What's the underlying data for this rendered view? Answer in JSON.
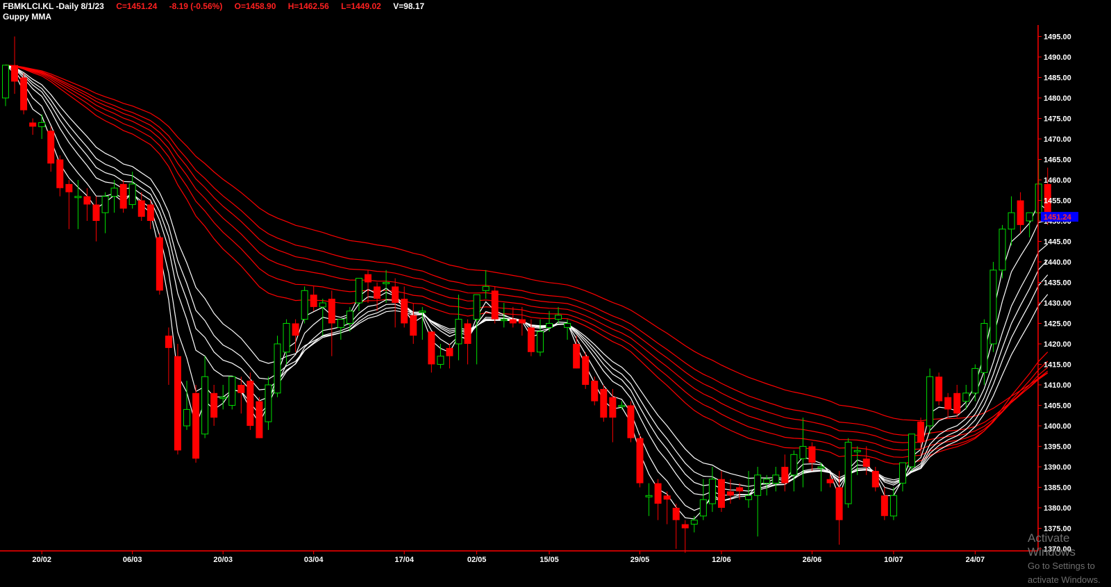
{
  "header": {
    "symbol": "FBMKLCI.KL",
    "period": "-Daily",
    "date": "8/1/23",
    "close": "C=1451.24",
    "change": "-8.19 (-0.56%)",
    "open": "O=1458.90",
    "high": "H=1462.56",
    "low": "L=1449.02",
    "volume": "V=98.17",
    "indicator": "Guppy MMA"
  },
  "price_tag": "1451.24",
  "watermark": {
    "line1": "Activate Windows",
    "line2": "Go to Settings to activate Windows."
  },
  "colors": {
    "background": "#000000",
    "up": "#00e000",
    "down": "#ff0000",
    "short_mma": "#ffffff",
    "long_mma": "#ff0000",
    "axis": "#ff0000",
    "axis_text": "#ffffff",
    "price_tag_bg": "#0000ff",
    "price_tag_text": "#ff3030"
  },
  "chart_data": {
    "type": "candlestick",
    "title": "FBMKLCI.KL -Daily 8/1/23",
    "ylim": [
      1368,
      1497
    ],
    "y_ticks": [
      1370,
      1375,
      1380,
      1385,
      1390,
      1395,
      1400,
      1405,
      1410,
      1415,
      1420,
      1425,
      1430,
      1435,
      1440,
      1445,
      1450,
      1455,
      1460,
      1465,
      1470,
      1475,
      1480,
      1485,
      1490,
      1495
    ],
    "x_ticks": [
      {
        "label": "20/02",
        "index": 4
      },
      {
        "label": "06/03",
        "index": 14
      },
      {
        "label": "20/03",
        "index": 24
      },
      {
        "label": "03/04",
        "index": 34
      },
      {
        "label": "17/04",
        "index": 44
      },
      {
        "label": "02/05",
        "index": 52
      },
      {
        "label": "15/05",
        "index": 60
      },
      {
        "label": "29/05",
        "index": 70
      },
      {
        "label": "12/06",
        "index": 79
      },
      {
        "label": "26/06",
        "index": 89
      },
      {
        "label": "10/07",
        "index": 98
      },
      {
        "label": "24/07",
        "index": 107
      }
    ],
    "candles": [
      {
        "o": 1480,
        "h": 1488,
        "l": 1478,
        "c": 1488
      },
      {
        "o": 1488,
        "h": 1495,
        "l": 1481,
        "c": 1484
      },
      {
        "o": 1485,
        "h": 1486,
        "l": 1476,
        "c": 1477
      },
      {
        "o": 1474,
        "h": 1475,
        "l": 1471,
        "c": 1473
      },
      {
        "o": 1473,
        "h": 1476,
        "l": 1470,
        "c": 1474
      },
      {
        "o": 1472,
        "h": 1473,
        "l": 1462,
        "c": 1464
      },
      {
        "o": 1465,
        "h": 1466,
        "l": 1456,
        "c": 1458
      },
      {
        "o": 1459,
        "h": 1460,
        "l": 1448,
        "c": 1457
      },
      {
        "o": 1456,
        "h": 1460,
        "l": 1448,
        "c": 1456
      },
      {
        "o": 1456,
        "h": 1458,
        "l": 1450,
        "c": 1454
      },
      {
        "o": 1454,
        "h": 1456,
        "l": 1445,
        "c": 1450
      },
      {
        "o": 1452,
        "h": 1457,
        "l": 1447,
        "c": 1456
      },
      {
        "o": 1456,
        "h": 1460,
        "l": 1452,
        "c": 1458
      },
      {
        "o": 1459,
        "h": 1460,
        "l": 1452,
        "c": 1453
      },
      {
        "o": 1454,
        "h": 1462,
        "l": 1453,
        "c": 1459
      },
      {
        "o": 1455,
        "h": 1457,
        "l": 1450,
        "c": 1451
      },
      {
        "o": 1454,
        "h": 1455,
        "l": 1448,
        "c": 1450
      },
      {
        "o": 1446,
        "h": 1447,
        "l": 1432,
        "c": 1433
      },
      {
        "o": 1422,
        "h": 1424,
        "l": 1410,
        "c": 1419
      },
      {
        "o": 1417,
        "h": 1420,
        "l": 1393,
        "c": 1394
      },
      {
        "o": 1400,
        "h": 1411,
        "l": 1399,
        "c": 1404
      },
      {
        "o": 1408,
        "h": 1410,
        "l": 1391,
        "c": 1392
      },
      {
        "o": 1398,
        "h": 1417,
        "l": 1397,
        "c": 1412
      },
      {
        "o": 1408,
        "h": 1410,
        "l": 1400,
        "c": 1402
      },
      {
        "o": 1407,
        "h": 1410,
        "l": 1404,
        "c": 1407
      },
      {
        "o": 1405,
        "h": 1412,
        "l": 1404,
        "c": 1412
      },
      {
        "o": 1410,
        "h": 1412,
        "l": 1403,
        "c": 1408
      },
      {
        "o": 1411,
        "h": 1413,
        "l": 1399,
        "c": 1400
      },
      {
        "o": 1406,
        "h": 1407,
        "l": 1397,
        "c": 1397
      },
      {
        "o": 1401,
        "h": 1412,
        "l": 1399,
        "c": 1410
      },
      {
        "o": 1408,
        "h": 1422,
        "l": 1407,
        "c": 1420
      },
      {
        "o": 1418,
        "h": 1426,
        "l": 1415,
        "c": 1425
      },
      {
        "o": 1425,
        "h": 1426,
        "l": 1418,
        "c": 1422
      },
      {
        "o": 1426,
        "h": 1434,
        "l": 1425,
        "c": 1433
      },
      {
        "o": 1432,
        "h": 1434,
        "l": 1428,
        "c": 1429
      },
      {
        "o": 1429,
        "h": 1431,
        "l": 1422,
        "c": 1430
      },
      {
        "o": 1431,
        "h": 1433,
        "l": 1417,
        "c": 1425
      },
      {
        "o": 1424,
        "h": 1426,
        "l": 1421,
        "c": 1426
      },
      {
        "o": 1425,
        "h": 1429,
        "l": 1423,
        "c": 1428
      },
      {
        "o": 1430,
        "h": 1436,
        "l": 1428,
        "c": 1436
      },
      {
        "o": 1437,
        "h": 1438,
        "l": 1430,
        "c": 1435
      },
      {
        "o": 1434,
        "h": 1435,
        "l": 1428,
        "c": 1431
      },
      {
        "o": 1435,
        "h": 1438,
        "l": 1430,
        "c": 1435
      },
      {
        "o": 1434,
        "h": 1436,
        "l": 1424,
        "c": 1430
      },
      {
        "o": 1431,
        "h": 1434,
        "l": 1424,
        "c": 1425
      },
      {
        "o": 1427,
        "h": 1430,
        "l": 1420,
        "c": 1422
      },
      {
        "o": 1428,
        "h": 1429,
        "l": 1421,
        "c": 1428
      },
      {
        "o": 1423,
        "h": 1423,
        "l": 1413,
        "c": 1415
      },
      {
        "o": 1415,
        "h": 1420,
        "l": 1414,
        "c": 1417
      },
      {
        "o": 1419,
        "h": 1420,
        "l": 1414,
        "c": 1417
      },
      {
        "o": 1420,
        "h": 1432,
        "l": 1416,
        "c": 1426
      },
      {
        "o": 1425,
        "h": 1426,
        "l": 1415,
        "c": 1420
      },
      {
        "o": 1426,
        "h": 1431,
        "l": 1415,
        "c": 1432
      },
      {
        "o": 1433,
        "h": 1438,
        "l": 1431,
        "c": 1434
      },
      {
        "o": 1433,
        "h": 1434,
        "l": 1425,
        "c": 1426
      },
      {
        "o": 1426,
        "h": 1430,
        "l": 1424,
        "c": 1426
      },
      {
        "o": 1426,
        "h": 1429,
        "l": 1424,
        "c": 1425
      },
      {
        "o": 1426,
        "h": 1429,
        "l": 1422,
        "c": 1425
      },
      {
        "o": 1424,
        "h": 1426,
        "l": 1417,
        "c": 1418
      },
      {
        "o": 1418,
        "h": 1426,
        "l": 1417,
        "c": 1423
      },
      {
        "o": 1424,
        "h": 1428,
        "l": 1423,
        "c": 1425
      },
      {
        "o": 1426,
        "h": 1429,
        "l": 1425,
        "c": 1427
      },
      {
        "o": 1424,
        "h": 1426,
        "l": 1421,
        "c": 1425
      },
      {
        "o": 1420,
        "h": 1422,
        "l": 1414,
        "c": 1414
      },
      {
        "o": 1417,
        "h": 1418,
        "l": 1409,
        "c": 1410
      },
      {
        "o": 1411,
        "h": 1412,
        "l": 1405,
        "c": 1406
      },
      {
        "o": 1409,
        "h": 1410,
        "l": 1401,
        "c": 1402
      },
      {
        "o": 1407,
        "h": 1409,
        "l": 1396,
        "c": 1402
      },
      {
        "o": 1405,
        "h": 1406,
        "l": 1404,
        "c": 1405
      },
      {
        "o": 1405,
        "h": 1406,
        "l": 1396,
        "c": 1397
      },
      {
        "o": 1397,
        "h": 1398,
        "l": 1385,
        "c": 1386
      },
      {
        "o": 1383,
        "h": 1386,
        "l": 1378,
        "c": 1383
      },
      {
        "o": 1386,
        "h": 1387,
        "l": 1377,
        "c": 1381
      },
      {
        "o": 1383,
        "h": 1384,
        "l": 1376,
        "c": 1382
      },
      {
        "o": 1380,
        "h": 1381,
        "l": 1370,
        "c": 1377
      },
      {
        "o": 1376,
        "h": 1377,
        "l": 1369,
        "c": 1375
      },
      {
        "o": 1376,
        "h": 1378,
        "l": 1374,
        "c": 1377
      },
      {
        "o": 1378,
        "h": 1387,
        "l": 1377,
        "c": 1382
      },
      {
        "o": 1381,
        "h": 1390,
        "l": 1379,
        "c": 1387
      },
      {
        "o": 1387,
        "h": 1389,
        "l": 1379,
        "c": 1380
      },
      {
        "o": 1384,
        "h": 1387,
        "l": 1381,
        "c": 1383
      },
      {
        "o": 1385,
        "h": 1386,
        "l": 1382,
        "c": 1384
      },
      {
        "o": 1382,
        "h": 1389,
        "l": 1380,
        "c": 1383
      },
      {
        "o": 1383,
        "h": 1390,
        "l": 1373,
        "c": 1388
      },
      {
        "o": 1386,
        "h": 1388,
        "l": 1383,
        "c": 1387
      },
      {
        "o": 1386,
        "h": 1390,
        "l": 1384,
        "c": 1388
      },
      {
        "o": 1390,
        "h": 1393,
        "l": 1384,
        "c": 1386
      },
      {
        "o": 1388,
        "h": 1394,
        "l": 1384,
        "c": 1393
      },
      {
        "o": 1392,
        "h": 1402,
        "l": 1385,
        "c": 1395
      },
      {
        "o": 1395,
        "h": 1396,
        "l": 1389,
        "c": 1391
      },
      {
        "o": 1390,
        "h": 1391,
        "l": 1384,
        "c": 1390
      },
      {
        "o": 1387,
        "h": 1388,
        "l": 1385,
        "c": 1386
      },
      {
        "o": 1385,
        "h": 1389,
        "l": 1371,
        "c": 1377
      },
      {
        "o": 1381,
        "h": 1397,
        "l": 1380,
        "c": 1396
      },
      {
        "o": 1394,
        "h": 1395,
        "l": 1388,
        "c": 1394
      },
      {
        "o": 1392,
        "h": 1395,
        "l": 1388,
        "c": 1390
      },
      {
        "o": 1389,
        "h": 1390,
        "l": 1384,
        "c": 1385
      },
      {
        "o": 1383,
        "h": 1385,
        "l": 1377,
        "c": 1378
      },
      {
        "o": 1378,
        "h": 1385,
        "l": 1377,
        "c": 1383
      },
      {
        "o": 1386,
        "h": 1391,
        "l": 1384,
        "c": 1391
      },
      {
        "o": 1390,
        "h": 1398,
        "l": 1389,
        "c": 1398
      },
      {
        "o": 1401,
        "h": 1402,
        "l": 1393,
        "c": 1396
      },
      {
        "o": 1400,
        "h": 1414,
        "l": 1398,
        "c": 1412
      },
      {
        "o": 1412,
        "h": 1413,
        "l": 1405,
        "c": 1406
      },
      {
        "o": 1407,
        "h": 1408,
        "l": 1402,
        "c": 1404
      },
      {
        "o": 1408,
        "h": 1410,
        "l": 1402,
        "c": 1403
      },
      {
        "o": 1406,
        "h": 1410,
        "l": 1404,
        "c": 1408
      },
      {
        "o": 1408,
        "h": 1415,
        "l": 1406,
        "c": 1414
      },
      {
        "o": 1413,
        "h": 1426,
        "l": 1410,
        "c": 1425
      },
      {
        "o": 1420,
        "h": 1440,
        "l": 1418,
        "c": 1438
      },
      {
        "o": 1438,
        "h": 1449,
        "l": 1436,
        "c": 1448
      },
      {
        "o": 1448,
        "h": 1456,
        "l": 1444,
        "c": 1452
      },
      {
        "o": 1455,
        "h": 1457,
        "l": 1447,
        "c": 1449
      },
      {
        "o": 1450,
        "h": 1452,
        "l": 1446,
        "c": 1452
      },
      {
        "o": 1452,
        "h": 1465,
        "l": 1450,
        "c": 1459
      },
      {
        "o": 1459,
        "h": 1463,
        "l": 1449,
        "c": 1451
      }
    ]
  }
}
